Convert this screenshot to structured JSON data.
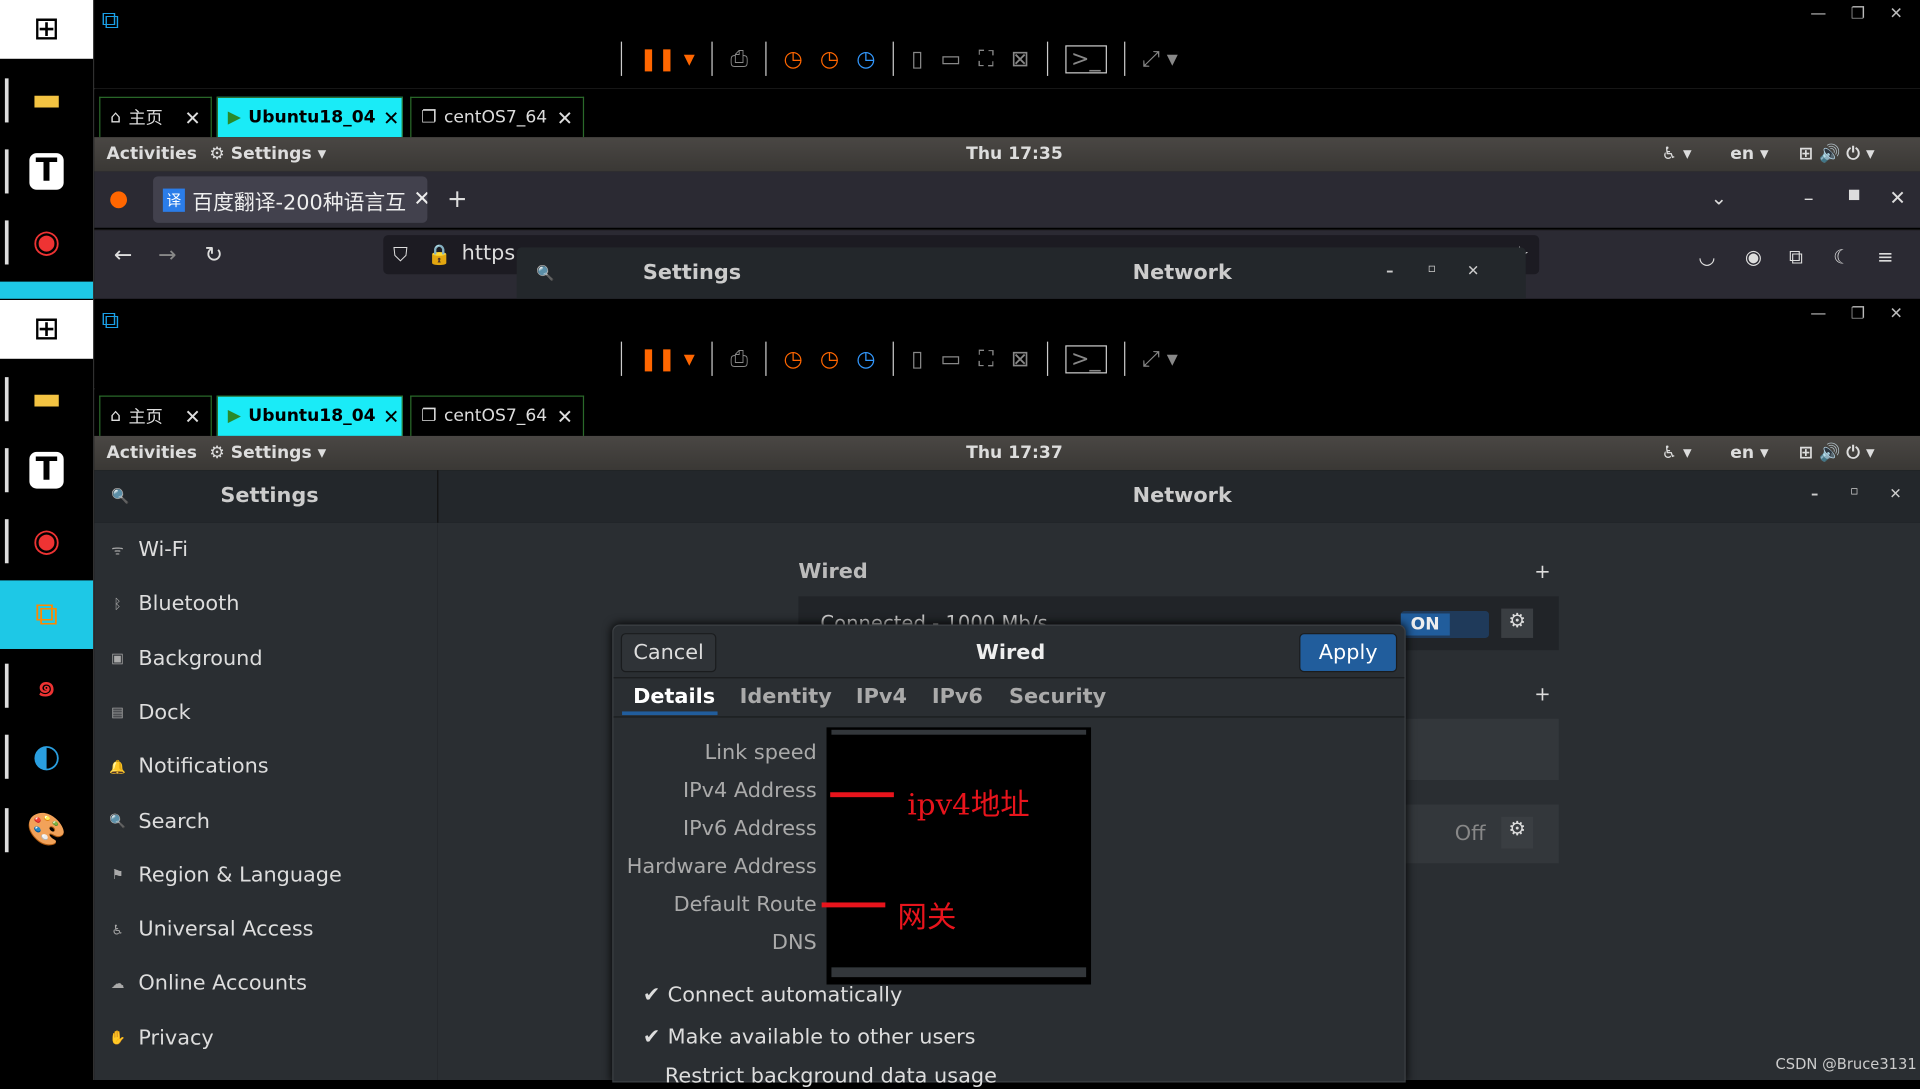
{
  "taskbar": {
    "items": [
      "windows-start",
      "file-explorer",
      "typora",
      "chrome",
      "windows-start",
      "file-explorer",
      "typora",
      "chrome",
      "vmware",
      "app-red",
      "edge",
      "paint"
    ]
  },
  "vm_back": {
    "tabs": [
      {
        "label": "主页"
      },
      {
        "label": "Ubuntu18_04"
      },
      {
        "label": "centOS7_64"
      }
    ],
    "topbar": {
      "activities": "Activities",
      "app": "Settings",
      "clock": "Thu 17:35",
      "lang": "en"
    },
    "firefox": {
      "tab_title": "百度翻译-200种语言互",
      "tab_icon_text": "译",
      "url": "https"
    },
    "settings_header": {
      "title": "Settings",
      "panel": "Network"
    }
  },
  "vm_front": {
    "tabs": [
      {
        "label": "主页"
      },
      {
        "label": "Ubuntu18_04"
      },
      {
        "label": "centOS7_64"
      }
    ],
    "topbar": {
      "activities": "Activities",
      "app": "Settings",
      "clock": "Thu 17:37",
      "lang": "en"
    },
    "header": {
      "title": "Settings",
      "panel": "Network"
    },
    "sidebar": {
      "items": [
        {
          "label": "Wi-Fi",
          "icon": "wifi-icon"
        },
        {
          "label": "Bluetooth",
          "icon": "bluetooth-icon"
        },
        {
          "label": "Background",
          "icon": "background-icon"
        },
        {
          "label": "Dock",
          "icon": "dock-icon"
        },
        {
          "label": "Notifications",
          "icon": "bell-icon"
        },
        {
          "label": "Search",
          "icon": "search-icon"
        },
        {
          "label": "Region & Language",
          "icon": "flag-icon"
        },
        {
          "label": "Universal Access",
          "icon": "accessibility-icon"
        },
        {
          "label": "Online Accounts",
          "icon": "accounts-icon"
        },
        {
          "label": "Privacy",
          "icon": "hand-icon"
        }
      ]
    },
    "network": {
      "wired_heading": "Wired",
      "connected": "Connected - 1000 Mb/s",
      "toggle": "ON",
      "off_label": "Off"
    },
    "dialog": {
      "cancel": "Cancel",
      "title": "Wired",
      "apply": "Apply",
      "tabs": [
        "Details",
        "Identity",
        "IPv4",
        "IPv6",
        "Security"
      ],
      "active_tab": "Details",
      "fields": [
        "Link speed",
        "IPv4 Address",
        "IPv6 Address",
        "Hardware Address",
        "Default Route",
        "DNS"
      ],
      "annotations": {
        "ipv4": "ipv4地址",
        "gateway": "网关"
      },
      "checks": [
        {
          "label": "Connect automatically",
          "checked": true
        },
        {
          "label": "Make available to other users",
          "checked": true
        },
        {
          "label": "Restrict background data usage",
          "checked": false
        }
      ]
    }
  },
  "watermark": "CSDN @Bruce3131"
}
